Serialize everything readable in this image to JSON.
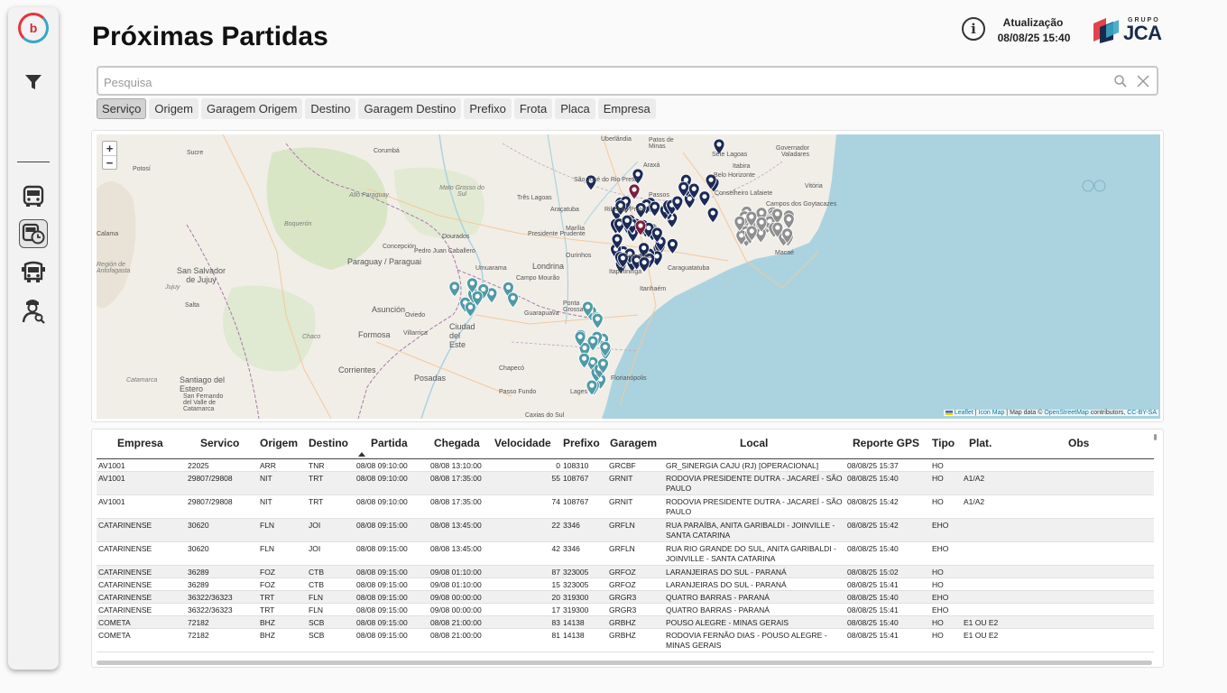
{
  "app": {
    "logo_text": "b",
    "title": "Próximas Partidas",
    "update_label": "Atualização",
    "update_value": "08/08/25 15:40",
    "brand_top": "GRUPO",
    "brand_name": "JCA"
  },
  "sidebar": {
    "items": [
      {
        "name": "filter-icon"
      },
      {
        "name": "bus-icon"
      },
      {
        "name": "bus-clock-icon",
        "active": true
      },
      {
        "name": "bus-front-icon"
      },
      {
        "name": "inspector-icon"
      }
    ]
  },
  "search": {
    "placeholder": "Pesquisa",
    "value": ""
  },
  "chips": [
    "Serviço",
    "Origem",
    "Garagem Origem",
    "Destino",
    "Garagem Destino",
    "Prefixo",
    "Frota",
    "Placa",
    "Empresa"
  ],
  "map": {
    "zoom_in": "+",
    "zoom_out": "−",
    "attribution": {
      "leaflet": "Leaflet",
      "icon_map": "Icon Map",
      "data": "Map data ©",
      "osm": "OpenStreetMap",
      "contrib": "contributors,",
      "license": "CC-BY-SA"
    },
    "labels": [
      "Uberlândia",
      "Patos de Minas",
      "Governador Valadares",
      "Sucre",
      "Potosí",
      "Corumbá",
      "Alto Paraguay",
      "Mato Grosso do Sul",
      "Três Lagoas",
      "Passos",
      "Araxá",
      "Sete Lagoas",
      "Itabira",
      "Belo Horizonte",
      "Conselheiro Lafaiete",
      "São José do Rio Preto",
      "Ribeirão Preto",
      "Araçatuba",
      "Marília",
      "Presidente Prudente",
      "Dourados",
      "Boquerón",
      "Concepción",
      "Pedro Juan Caballero",
      "Paraguay / Paraguai",
      "Umuarama",
      "Londrina",
      "Campo Mourão",
      "Ourinhos",
      "Sorocaba",
      "Itapetininga",
      "Caraguatatuba",
      "Campos dos Goytacazes",
      "Vitória",
      "Macaé",
      "Salta",
      "San Salvador de Jujuy",
      "Jujuy",
      "Región de Antofagasta",
      "Calama",
      "Asunción",
      "Oviedo",
      "Villarrica",
      "Ciudad del Este",
      "Guarapuava",
      "Ponta Grossa",
      "Formosa",
      "Chaco",
      "Corrientes",
      "Posadas",
      "Chapecó",
      "Passo Fundo",
      "Caxias do Sul",
      "Santiago del Estero",
      "San Fernando del Valle de Catamarca",
      "Catamarca",
      "Florianópolis",
      "Itanhaém",
      "Lages"
    ]
  },
  "table": {
    "columns": [
      "Empresa",
      "Servico",
      "Origem",
      "Destino",
      "Partida",
      "Chegada",
      "Velocidade",
      "Prefixo",
      "Garagem",
      "Local",
      "Reporte GPS",
      "Tipo",
      "Plat.",
      "Obs"
    ],
    "sorted_column": "Partida",
    "rows": [
      {
        "empresa": "AV1001",
        "servico": "22025",
        "origem": "ARR",
        "destino": "TNR",
        "partida": "08/08 09:10:00",
        "chegada": "08/08 13:10:00",
        "velocidade": "0",
        "prefixo": "108310",
        "garagem": "GRCBF",
        "local": "GR_SINERGIA CAJU (RJ) [OPERACIONAL]",
        "reporte": "08/08/25 15:37",
        "tipo": "HO",
        "plat": "",
        "obs": ""
      },
      {
        "empresa": "AV1001",
        "servico": "29807/29808",
        "origem": "NIT",
        "destino": "TRT",
        "partida": "08/08 09:10:00",
        "chegada": "08/08 17:35:00",
        "velocidade": "55",
        "prefixo": "108767",
        "garagem": "GRNIT",
        "local": "RODOVIA PRESIDENTE DUTRA - JACAREÍ - SÃO PAULO",
        "reporte": "08/08/25 15:40",
        "tipo": "HO",
        "plat": "A1/A2",
        "obs": ""
      },
      {
        "empresa": "AV1001",
        "servico": "29807/29808",
        "origem": "NIT",
        "destino": "TRT",
        "partida": "08/08 09:10:00",
        "chegada": "08/08 17:35:00",
        "velocidade": "74",
        "prefixo": "108767",
        "garagem": "GRNIT",
        "local": "RODOVIA PRESIDENTE DUTRA - JACAREÍ - SÃO PAULO",
        "reporte": "08/08/25 15:42",
        "tipo": "HO",
        "plat": "A1/A2",
        "obs": ""
      },
      {
        "empresa": "CATARINENSE",
        "servico": "30620",
        "origem": "FLN",
        "destino": "JOI",
        "partida": "08/08 09:15:00",
        "chegada": "08/08 13:45:00",
        "velocidade": "22",
        "prefixo": "3346",
        "garagem": "GRFLN",
        "local": "RUA PARAÍBA, ANITA GARIBALDI - JOINVILLE - SANTA CATARINA",
        "reporte": "08/08/25 15:42",
        "tipo": "EHO",
        "plat": "",
        "obs": ""
      },
      {
        "empresa": "CATARINENSE",
        "servico": "30620",
        "origem": "FLN",
        "destino": "JOI",
        "partida": "08/08 09:15:00",
        "chegada": "08/08 13:45:00",
        "velocidade": "42",
        "prefixo": "3346",
        "garagem": "GRFLN",
        "local": "RUA RIO GRANDE DO SUL, ANITA GARIBALDI - JOINVILLE - SANTA CATARINA",
        "reporte": "08/08/25 15:40",
        "tipo": "EHO",
        "plat": "",
        "obs": ""
      },
      {
        "empresa": "CATARINENSE",
        "servico": "36289",
        "origem": "FOZ",
        "destino": "CTB",
        "partida": "08/08 09:15:00",
        "chegada": "09/08 01:10:00",
        "velocidade": "87",
        "prefixo": "323005",
        "garagem": "GRFOZ",
        "local": "LARANJEIRAS DO SUL - PARANÁ",
        "reporte": "08/08/25 15:02",
        "tipo": "HO",
        "plat": "",
        "obs": ""
      },
      {
        "empresa": "CATARINENSE",
        "servico": "36289",
        "origem": "FOZ",
        "destino": "CTB",
        "partida": "08/08 09:15:00",
        "chegada": "09/08 01:10:00",
        "velocidade": "15",
        "prefixo": "323005",
        "garagem": "GRFOZ",
        "local": "LARANJEIRAS DO SUL - PARANÁ",
        "reporte": "08/08/25 15:41",
        "tipo": "HO",
        "plat": "",
        "obs": ""
      },
      {
        "empresa": "CATARINENSE",
        "servico": "36322/36323",
        "origem": "TRT",
        "destino": "FLN",
        "partida": "08/08 09:15:00",
        "chegada": "09/08 00:00:00",
        "velocidade": "20",
        "prefixo": "319300",
        "garagem": "GRGR3",
        "local": "QUATRO BARRAS - PARANÁ",
        "reporte": "08/08/25 15:40",
        "tipo": "EHO",
        "plat": "",
        "obs": ""
      },
      {
        "empresa": "CATARINENSE",
        "servico": "36322/36323",
        "origem": "TRT",
        "destino": "FLN",
        "partida": "08/08 09:15:00",
        "chegada": "09/08 00:00:00",
        "velocidade": "17",
        "prefixo": "319300",
        "garagem": "GRGR3",
        "local": "QUATRO BARRAS - PARANÁ",
        "reporte": "08/08/25 15:41",
        "tipo": "EHO",
        "plat": "",
        "obs": ""
      },
      {
        "empresa": "COMETA",
        "servico": "72182",
        "origem": "BHZ",
        "destino": "SCB",
        "partida": "08/08 09:15:00",
        "chegada": "08/08 21:00:00",
        "velocidade": "83",
        "prefixo": "14138",
        "garagem": "GRBHZ",
        "local": "POUSO ALEGRE - MINAS GERAIS",
        "reporte": "08/08/25 15:40",
        "tipo": "HO",
        "plat": "E1 OU E2",
        "obs": ""
      },
      {
        "empresa": "COMETA",
        "servico": "72182",
        "origem": "BHZ",
        "destino": "SCB",
        "partida": "08/08 09:15:00",
        "chegada": "08/08 21:00:00",
        "velocidade": "81",
        "prefixo": "14138",
        "garagem": "GRBHZ",
        "local": "RODOVIA FERNÃO DIAS - POUSO ALEGRE - MINAS GERAIS",
        "reporte": "08/08/25 15:41",
        "tipo": "HO",
        "plat": "E1 OU E2",
        "obs": ""
      }
    ]
  },
  "colors": {
    "ocean": "#aad3df",
    "land": "#f1eee8",
    "marker_navy": "#1b2a57",
    "marker_teal": "#4f9aa6",
    "marker_gray": "#8f8f8f",
    "marker_maroon": "#7a1f3d"
  }
}
